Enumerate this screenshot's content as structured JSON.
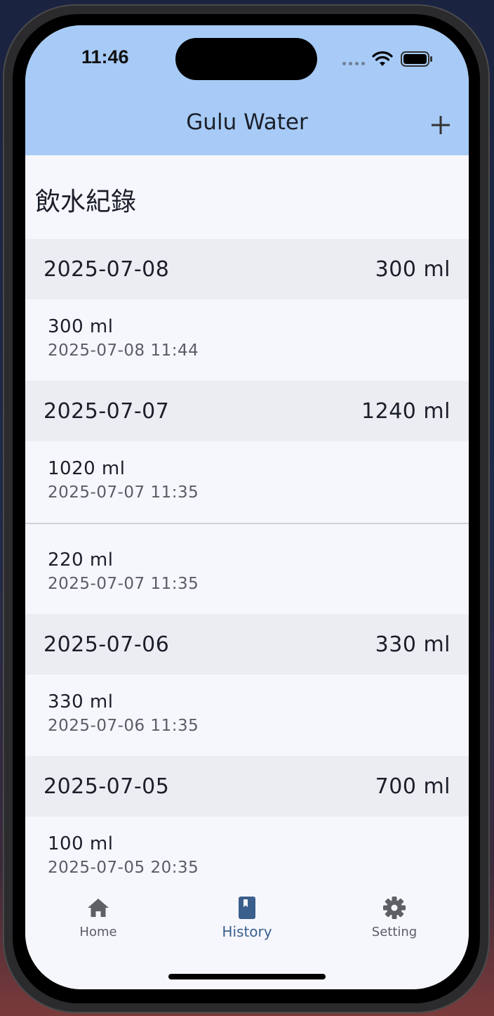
{
  "status": {
    "time": "11:46"
  },
  "appbar": {
    "title": "Gulu Water",
    "add_icon": "plus-icon"
  },
  "page": {
    "heading": "飲水紀錄"
  },
  "days": [
    {
      "date": "2025-07-08",
      "total": "300 ml",
      "entries": [
        {
          "amount": "300 ml",
          "time": "2025-07-08 11:44"
        }
      ]
    },
    {
      "date": "2025-07-07",
      "total": "1240 ml",
      "entries": [
        {
          "amount": "1020 ml",
          "time": "2025-07-07 11:35"
        },
        {
          "amount": "220 ml",
          "time": "2025-07-07 11:35"
        }
      ]
    },
    {
      "date": "2025-07-06",
      "total": "330 ml",
      "entries": [
        {
          "amount": "330 ml",
          "time": "2025-07-06 11:35"
        }
      ]
    },
    {
      "date": "2025-07-05",
      "total": "700 ml",
      "entries": [
        {
          "amount": "100 ml",
          "time": "2025-07-05 20:35"
        }
      ]
    }
  ],
  "tabs": [
    {
      "label": "Home",
      "icon": "home-icon",
      "active": false
    },
    {
      "label": "History",
      "icon": "book-icon",
      "active": true
    },
    {
      "label": "Setting",
      "icon": "gear-icon",
      "active": false
    }
  ],
  "colors": {
    "appbar": "#a7cbf6",
    "active_tab": "#3a5f8c",
    "day_header_bg": "#ecedf2"
  }
}
